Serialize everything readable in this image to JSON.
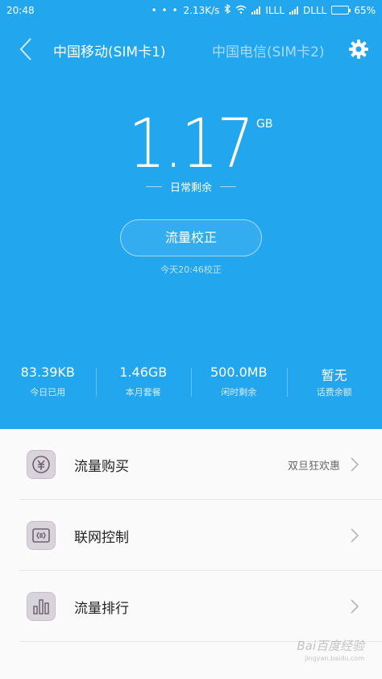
{
  "status_bar": {
    "time": "20:48",
    "dots": "• • •",
    "speed": "2.13K/s",
    "carrier1": "ILLL",
    "carrier2": "DLLL",
    "battery": "65%"
  },
  "header": {
    "sim1_label": "中国移动(SIM卡1)",
    "sim2_label": "中国电信(SIM卡2)"
  },
  "usage": {
    "value": "1.17",
    "unit": "GB",
    "label": "日常剩余"
  },
  "calibrate": {
    "button_label": "流量校正",
    "last_time": "今天20:46校正"
  },
  "stats": [
    {
      "value": "83.39KB",
      "label": "今日已用"
    },
    {
      "value": "1.46GB",
      "label": "本月套餐"
    },
    {
      "value": "500.0MB",
      "label": "闲时剩余"
    },
    {
      "value": "暂无",
      "label": "话费余额"
    }
  ],
  "menu": [
    {
      "title": "流量购买",
      "extra": "双旦狂欢惠",
      "icon": "purchase-icon"
    },
    {
      "title": "联网控制",
      "extra": "",
      "icon": "network-control-icon"
    },
    {
      "title": "流量排行",
      "extra": "",
      "icon": "ranking-icon"
    }
  ],
  "watermark": {
    "text": "Bai百度经验",
    "sub": "jingyan.baidu.com"
  },
  "colors": {
    "primary": "#22a6ee",
    "icon_bg": "#d9d4db"
  }
}
